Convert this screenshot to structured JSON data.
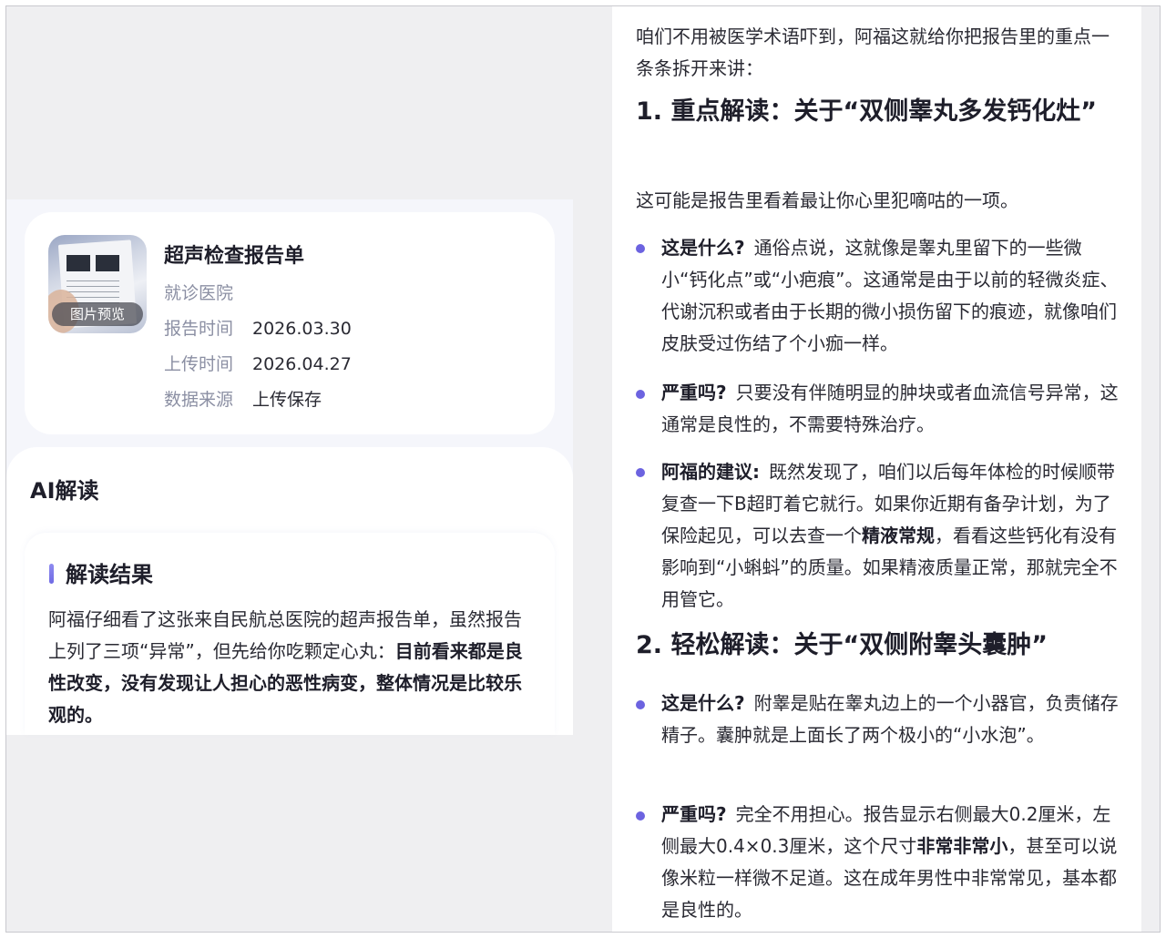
{
  "report": {
    "title": "超声检查报告单",
    "thumb_label": "图片预览",
    "hospital_label": "就诊医院",
    "hospital_value": "",
    "report_time_label": "报告时间",
    "report_time_value": "2026.03.30",
    "upload_time_label": "上传时间",
    "upload_time_value": "2026.04.27",
    "source_label": "数据来源",
    "source_value": "上传保存"
  },
  "ai": {
    "title": "AI解读",
    "result_heading": "解读结果",
    "result_text": "阿福仔细看了这张来自民航总医院的超声报告单，虽然报告上列了三项“异常”，但先给你吃颗定心丸：",
    "result_bold": "目前看来都是良性改变，没有发现让人担心的恶性病变，整体情况是比较乐观的。"
  },
  "article": {
    "intro": "咱们不用被医学术语吓到，阿福这就给你把报告里的重点一条条拆开来讲：",
    "section1_title": "1. 重点解读：关于“双侧睾丸多发钙化灶”",
    "section1_intro": "这可能是报告里看着最让你心里犯嘀咕的一项。",
    "s1_b1_label": "这是什么?",
    "s1_b1_text": "通俗点说，这就像是睾丸里留下的一些微小“钙化点”或“小疤痕”。这通常是由于以前的轻微炎症、代谢沉积或者由于长期的微小损伤留下的痕迹，就像咱们皮肤受过伤结了个小痂一样。",
    "s1_b2_label": "严重吗?",
    "s1_b2_text": "只要没有伴随明显的肿块或者血流信号异常，这通常是良性的，不需要特殊治疗。",
    "s1_b3_label": "阿福的建议:",
    "s1_b3_text1": "既然发现了，咱们以后每年体检的时候顺带复查一下B超盯着它就行。如果你近期有备孕计划，为了保险起见，可以去查一个",
    "s1_b3_bold": "精液常规",
    "s1_b3_text2": "，看看这些钙化有没有影响到“小蝌蚪”的质量。如果精液质量正常，那就完全不用管它。",
    "section2_title": "2. 轻松解读：关于“双侧附睾头囊肿”",
    "s2_b1_label": "这是什么?",
    "s2_b1_text": "附睾是贴在睾丸边上的一个小器官，负责储存精子。囊肿就是上面长了两个极小的“小水泡”。",
    "s2_b2_label": "严重吗?",
    "s2_b2_text1": "完全不用担心。报告显示右侧最大0.2厘米，左侧最大0.4×0.3厘米，这个尺寸",
    "s2_b2_bold": "非常非常小",
    "s2_b2_text2": "，甚至可以说像米粒一样微不足道。这在成年男性中非常常见，基本都是良性的。"
  }
}
